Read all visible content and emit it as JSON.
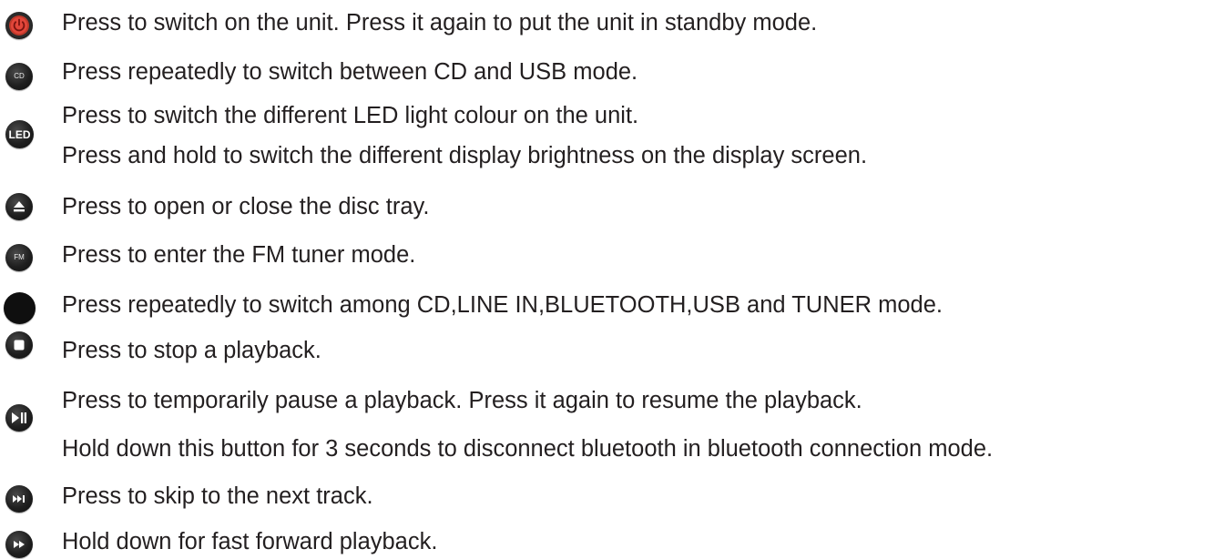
{
  "items": [
    {
      "icon": "power-icon",
      "lines": [
        "Press to switch on the unit. Press it again to put the unit in standby mode."
      ]
    },
    {
      "icon": "cd-icon",
      "icon_text": "CD",
      "lines": [
        "Press repeatedly to switch between CD and USB mode."
      ]
    },
    {
      "icon": "led-icon",
      "icon_text": "LED",
      "lines": [
        "Press to switch the different LED light colour on the unit.",
        "Press and hold to switch the different display brightness on the display screen."
      ]
    },
    {
      "icon": "eject-icon",
      "lines": [
        "Press to open or close the disc tray."
      ]
    },
    {
      "icon": "fm-icon",
      "icon_text": "FM",
      "lines": [
        "Press to enter the FM tuner mode."
      ]
    },
    {
      "icon": "source-icon",
      "lines": [
        "Press repeatedly to switch among CD,LINE IN,BLUETOOTH,USB and TUNER mode."
      ]
    },
    {
      "icon": "stop-icon",
      "lines": [
        "Press to stop a playback."
      ]
    },
    {
      "icon": "play-pause-icon",
      "lines": [
        "Press to temporarily pause a playback. Press it again to resume the playback.",
        "Hold down this button for 3 seconds to disconnect bluetooth in bluetooth connection mode."
      ]
    },
    {
      "icon": "skip-next-icon",
      "lines": [
        "Press to skip to the next track."
      ]
    },
    {
      "icon": "fast-forward-icon",
      "lines": [
        "Hold down for fast forward playback."
      ]
    }
  ],
  "colors": {
    "text": "#231f20",
    "button": "#1f1f1f",
    "power_accent": "#d9342b"
  }
}
